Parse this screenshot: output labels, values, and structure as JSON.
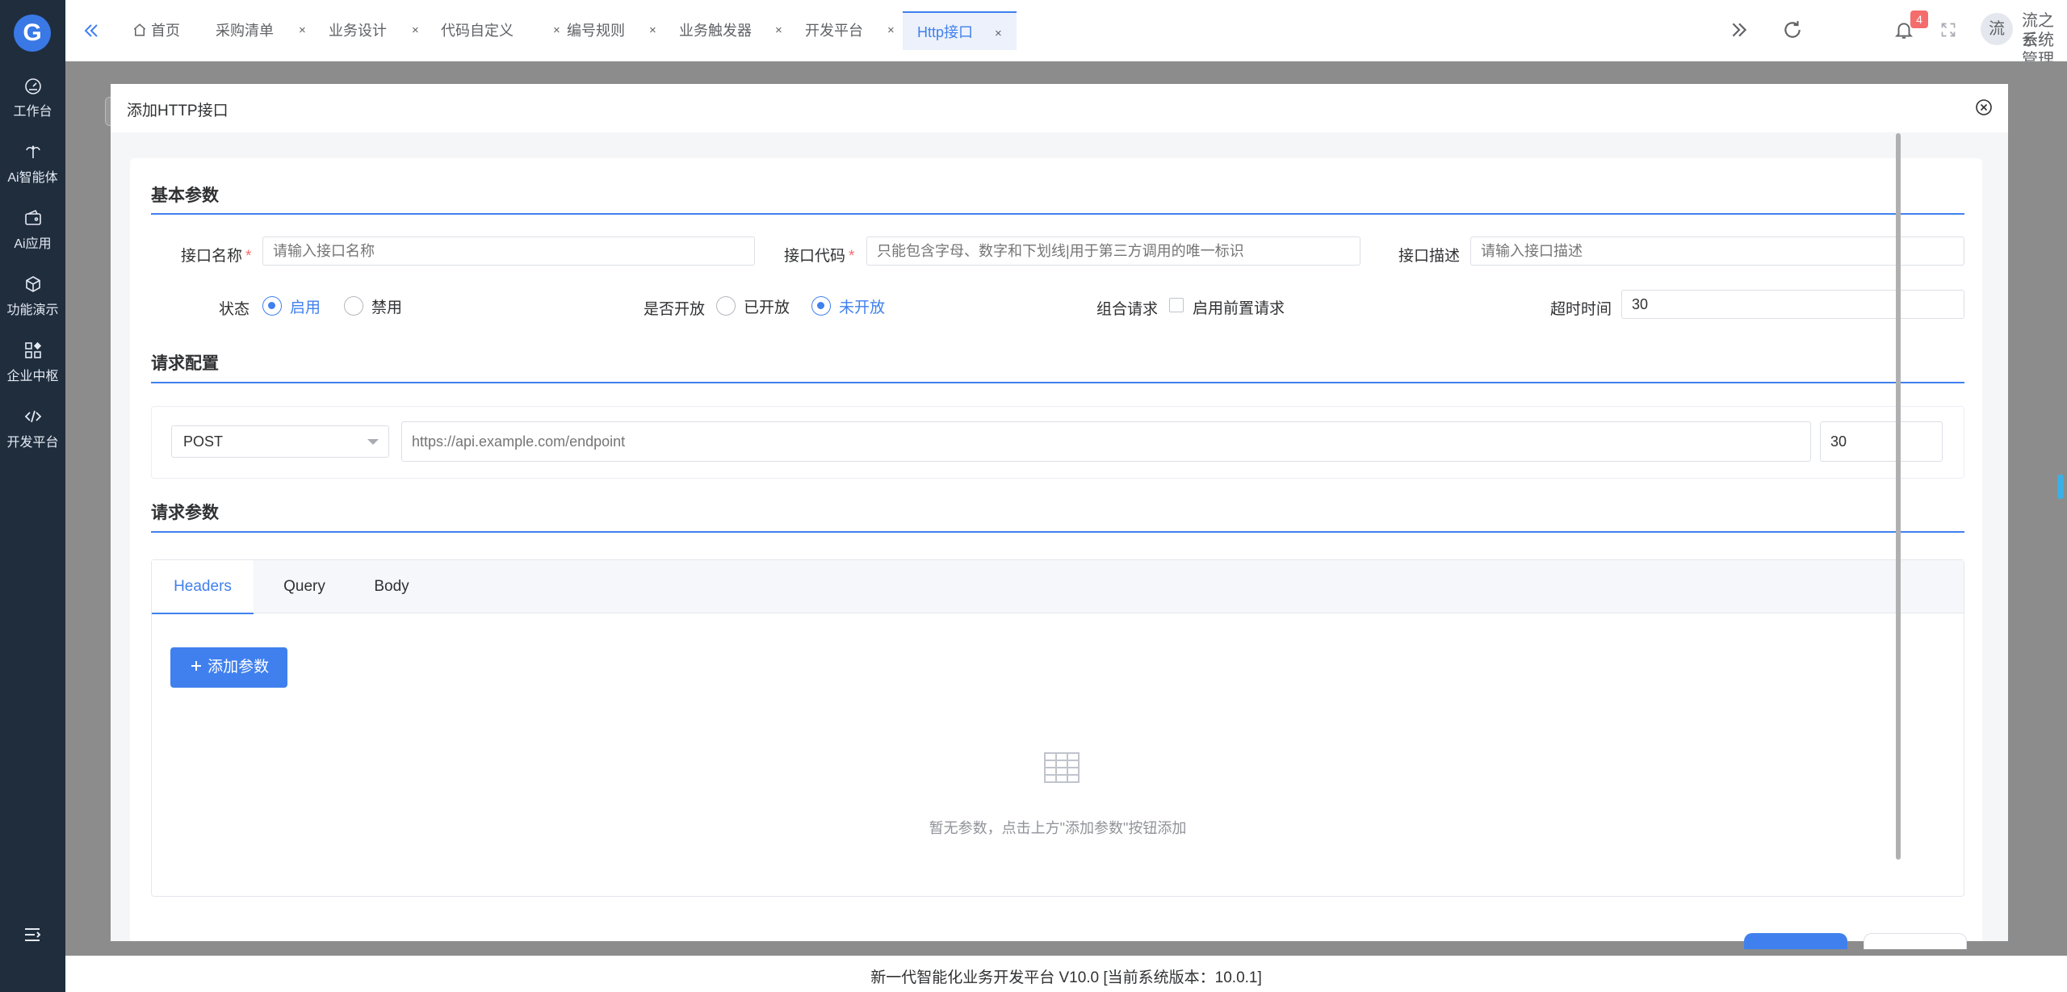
{
  "sidebar": {
    "items": [
      {
        "label": "工作台",
        "icon": "dashboard-icon"
      },
      {
        "label": "Ai智能体",
        "icon": "ai-agent-icon"
      },
      {
        "label": "Ai应用",
        "icon": "ai-app-icon"
      },
      {
        "label": "功能演示",
        "icon": "cube-icon"
      },
      {
        "label": "企业中枢",
        "icon": "grid-icon"
      },
      {
        "label": "开发平台",
        "icon": "code-icon"
      }
    ]
  },
  "tabs": [
    {
      "label": "首页"
    },
    {
      "label": "采购清单"
    },
    {
      "label": "业务设计"
    },
    {
      "label": "代码自定义"
    },
    {
      "label": "编号规则"
    },
    {
      "label": "业务触发器"
    },
    {
      "label": "开发平台"
    },
    {
      "label": "Http接口"
    }
  ],
  "tab_close_glyph": "×",
  "notifications": {
    "count": "4"
  },
  "user": {
    "avatar_char": "流",
    "name": "流之云",
    "role": "系统管理员"
  },
  "dialog": {
    "title": "添加HTTP接口",
    "sections": {
      "basic": "基本参数",
      "request_config": "请求配置",
      "request_params": "请求参数"
    },
    "fields": {
      "name": {
        "label": "接口名称",
        "required": "*",
        "placeholder": "请输入接口名称"
      },
      "code": {
        "label": "接口代码",
        "required": "*",
        "placeholder": "只能包含字母、数字和下划线|用于第三方调用的唯一标识"
      },
      "desc": {
        "label": "接口描述",
        "placeholder": "请输入接口描述"
      },
      "status": {
        "label": "状态",
        "options": [
          "启用",
          "禁用"
        ],
        "selected": "启用"
      },
      "open": {
        "label": "是否开放",
        "options": [
          "已开放",
          "未开放"
        ],
        "selected": "未开放"
      },
      "combo": {
        "label": "组合请求",
        "checkbox_label": "启用前置请求",
        "checked": false
      },
      "timeout": {
        "label": "超时时间",
        "value": "30"
      }
    },
    "request": {
      "method": "POST",
      "url_placeholder": "https://api.example.com/endpoint",
      "timeout": "30"
    },
    "param_tabs": [
      "Headers",
      "Query",
      "Body"
    ],
    "active_param_tab": "Headers",
    "add_param_button": "添加参数",
    "empty_text": "暂无参数，点击上方\"添加参数\"按钮添加"
  },
  "footer": {
    "copyright": "新一代智能化业务开发平台 V10.0 [当前系统版本：10.0.1]"
  },
  "colors": {
    "primary": "#4080ee",
    "sidebar": "#1f2d3d",
    "danger": "#f56c6c"
  }
}
